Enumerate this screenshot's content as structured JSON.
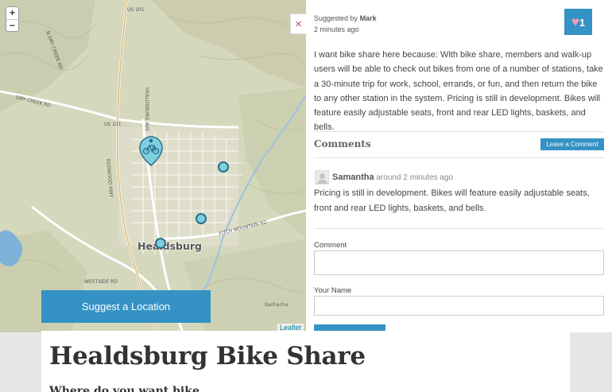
{
  "map": {
    "zoom_in": "+",
    "zoom_out": "−",
    "attribution": "Leaflet",
    "town_label": "Healdsburg",
    "road_labels": [
      "US 101",
      "US 101",
      "DRY CREEK RD",
      "W DRY CREEK RD",
      "HEALDSBURG AVE",
      "FITCH MOUNTAIN RD",
      "WESTSIDE RD",
      "REDWOOD HWY",
      "Bailhache"
    ],
    "marker_icon": "bicycle-icon",
    "colors": {
      "marker": "#7ecfe0",
      "marker_stroke": "#2b6e86",
      "accent": "#3592c4"
    }
  },
  "suggest_label": "Suggest a Location",
  "close_label": "×",
  "suggestion": {
    "suggested_by_prefix": "Suggested by",
    "author": "Mark",
    "time": "2 minutes ago",
    "likes": "1",
    "text": "I want bike share here because: With bike share, members and walk-up users will be able to check out bikes from one of a number of stations, take a 30-minute trip for work, school, errands, or fun, and then return the bike to any other station in the system. Pricing is still in development. Bikes will feature easily adjustable seats, front and rear LED lights, baskets, and bells."
  },
  "comments": {
    "title": "Comments",
    "leave_label": "Leave a Comment",
    "items": [
      {
        "author": "Samantha",
        "time": "around 2 minutes ago",
        "text": "Pricing is still in development. Bikes will feature easily adjustable seats, front and rear LED lights, baskets, and bells."
      }
    ]
  },
  "form": {
    "comment_label": "Comment",
    "name_label": "Your Name"
  },
  "page": {
    "title": "Healdsburg Bike Share",
    "subtitle": "Where do you want bike"
  }
}
